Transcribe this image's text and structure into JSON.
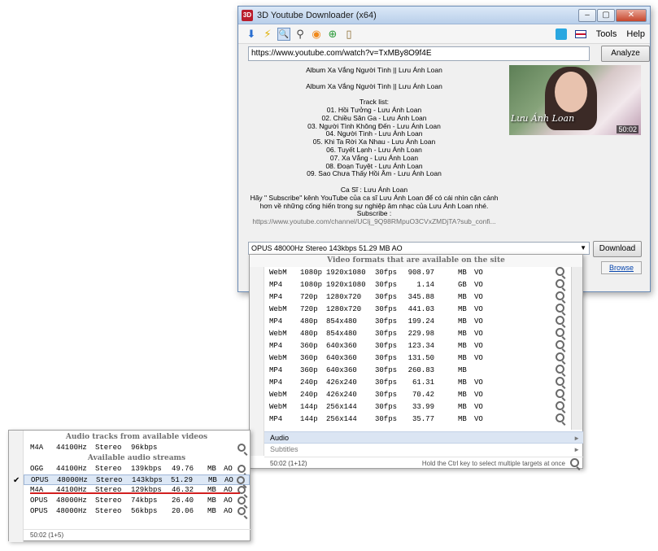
{
  "window": {
    "title": "3D Youtube Downloader (x64)",
    "min": "–",
    "max": "▢",
    "close": "✕"
  },
  "toolbar": {
    "icons": [
      "download-arrow",
      "lightning",
      "magnifier",
      "binoculars",
      "rss",
      "globe-add",
      "clipboard"
    ],
    "glyphs": [
      "⬇",
      "⚡",
      "🔍",
      "⚲",
      "◉",
      "⊕",
      "▯"
    ],
    "tools": "Tools",
    "help": "Help"
  },
  "url": {
    "value": "https://www.youtube.com/watch?v=TxMBy8O9f4E",
    "analyze": "Analyze"
  },
  "description": {
    "lines": [
      "Album Xa Vắng Người Tình || Lưu Ánh Loan",
      "",
      "Album Xa Vắng Người Tình || Lưu Ánh Loan",
      "",
      "Track list:",
      "01. Hồi Tưởng - Lưu Ánh Loan",
      "02. Chiều Sân Ga - Lưu Ánh Loan",
      "03. Người Tình Không Đến - Lưu Ánh Loan",
      "04. Người Tình - Lưu Ánh Loan",
      "05. Khi Ta Rời Xa Nhau - Lưu Ánh Loan",
      "06. Tuyết Lạnh - Lưu Ánh Loan",
      "07. Xa Vắng - Lưu Ánh Loan",
      "08. Đoạn Tuyệt - Lưu Ánh Loan",
      "09. Sao Chưa Thấy Hồi Âm - Lưu Ánh Loan",
      "",
      "Ca Sĩ : Lưu Ánh Loan",
      "Hãy \" Subscribe\" kênh YouTube của ca sĩ Lưu Ánh Loan để có cái nhìn cận cảnh",
      "hơn về những cống hiến trong sự nghiệp âm nhạc của Lưu Ánh Loan nhé.",
      "Subscribe :"
    ],
    "link": "https://www.youtube.com/channel/UClj_9Q98RMpuO3CVxZMDjTA?sub_confi..."
  },
  "thumbnail": {
    "caption": "Lưu Ánh Loan",
    "duration": "50:02"
  },
  "format_select": {
    "value": "OPUS 48000Hz Stereo 143kbps 51.29 MB AO",
    "arrow": "▼"
  },
  "download": "Download",
  "browse": "Browse",
  "video_popup": {
    "header": "Video formats that are available on the site",
    "rows": [
      [
        "WebM",
        "1080p",
        "1920x1080",
        "30fps",
        "908.97",
        "MB",
        "VO"
      ],
      [
        "MP4",
        "1080p",
        "1920x1080",
        "30fps",
        "1.14",
        "GB",
        "VO"
      ],
      [
        "MP4",
        "720p",
        "1280x720",
        "30fps",
        "345.88",
        "MB",
        "VO"
      ],
      [
        "WebM",
        "720p",
        "1280x720",
        "30fps",
        "441.03",
        "MB",
        "VO"
      ],
      [
        "MP4",
        "480p",
        "854x480",
        "30fps",
        "199.24",
        "MB",
        "VO"
      ],
      [
        "WebM",
        "480p",
        "854x480",
        "30fps",
        "229.98",
        "MB",
        "VO"
      ],
      [
        "MP4",
        "360p",
        "640x360",
        "30fps",
        "123.34",
        "MB",
        "VO"
      ],
      [
        "WebM",
        "360p",
        "640x360",
        "30fps",
        "131.50",
        "MB",
        "VO"
      ],
      [
        "MP4",
        "360p",
        "640x360",
        "30fps",
        "260.83",
        "MB",
        ""
      ],
      [
        "MP4",
        "240p",
        "426x240",
        "30fps",
        "61.31",
        "MB",
        "VO"
      ],
      [
        "WebM",
        "240p",
        "426x240",
        "30fps",
        "70.42",
        "MB",
        "VO"
      ],
      [
        "WebM",
        "144p",
        "256x144",
        "30fps",
        "33.99",
        "MB",
        "VO"
      ],
      [
        "MP4",
        "144p",
        "256x144",
        "30fps",
        "35.77",
        "MB",
        "VO"
      ]
    ],
    "audio_item": "Audio",
    "subtitles_item": "Subtitles",
    "chevron": "►",
    "footer_left": "50:02 (1+12)",
    "footer_hint": "Hold the Ctrl key to select multiple targets at once"
  },
  "audio_popup": {
    "tracks_header": "Audio tracks from available videos",
    "tracks": [
      [
        "M4A",
        "44100Hz",
        "Stereo",
        "96kbps",
        "",
        "",
        ""
      ]
    ],
    "streams_header": "Available audio streams",
    "streams": [
      [
        "OGG",
        "44100Hz",
        "Stereo",
        "139kbps",
        "49.76",
        "MB",
        "AO"
      ],
      [
        "OPUS",
        "48000Hz",
        "Stereo",
        "143kbps",
        "51.29",
        "MB",
        "AO"
      ],
      [
        "M4A",
        "44100Hz",
        "Stereo",
        "129kbps",
        "46.32",
        "MB",
        "AO"
      ],
      [
        "OPUS",
        "48000Hz",
        "Stereo",
        "74kbps",
        "26.40",
        "MB",
        "AO"
      ],
      [
        "OPUS",
        "48000Hz",
        "Stereo",
        "56kbps",
        "20.06",
        "MB",
        "AO"
      ]
    ],
    "check": "✔",
    "footer": "50:02 (1+5)"
  }
}
